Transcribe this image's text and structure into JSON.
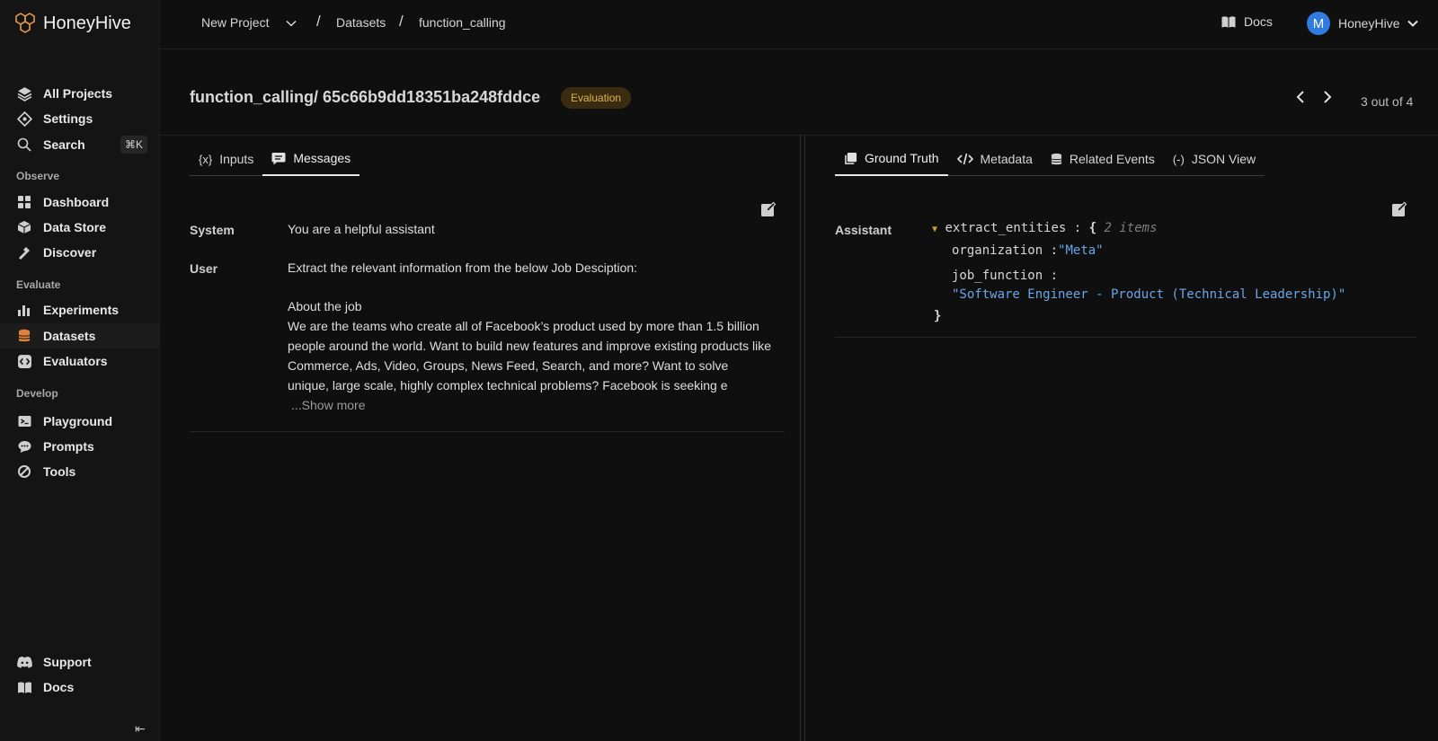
{
  "app": {
    "name": "HoneyHive"
  },
  "sidebar": {
    "items_top": [
      {
        "label": "All Projects",
        "icon": "layers-icon"
      },
      {
        "label": "Settings",
        "icon": "settings-icon"
      },
      {
        "label": "Search",
        "icon": "search-icon",
        "shortcut": "⌘K"
      }
    ],
    "sections": [
      {
        "label": "Observe",
        "items": [
          {
            "label": "Dashboard",
            "icon": "dashboard-icon"
          },
          {
            "label": "Data Store",
            "icon": "data-store-icon"
          },
          {
            "label": "Discover",
            "icon": "discover-icon"
          }
        ]
      },
      {
        "label": "Evaluate",
        "items": [
          {
            "label": "Experiments",
            "icon": "bar-chart-icon"
          },
          {
            "label": "Datasets",
            "icon": "database-icon",
            "active": true
          },
          {
            "label": "Evaluators",
            "icon": "evaluator-icon"
          }
        ]
      },
      {
        "label": "Develop",
        "items": [
          {
            "label": "Playground",
            "icon": "terminal-icon"
          },
          {
            "label": "Prompts",
            "icon": "chat-icon"
          },
          {
            "label": "Tools",
            "icon": "tools-icon"
          }
        ]
      }
    ],
    "bottom": [
      {
        "label": "Support",
        "icon": "discord-icon"
      },
      {
        "label": "Docs",
        "icon": "book-icon"
      }
    ],
    "collapse_glyph": "⇤"
  },
  "topbar": {
    "project": "New Project",
    "crumbs": [
      "Datasets",
      "function_calling"
    ],
    "separator": "/",
    "docs": "Docs",
    "user_initial": "M",
    "user_name": "HoneyHive"
  },
  "header": {
    "title": "function_calling/ 65c66b9dd18351ba248fddce",
    "badge": "Evaluation",
    "pager": "3 out of 4",
    "prev": "‹",
    "next": "›"
  },
  "left_panel": {
    "tabs": [
      {
        "label": "Inputs",
        "icon": "{x}"
      },
      {
        "label": "Messages",
        "icon": "message-icon",
        "active": true
      }
    ],
    "messages": [
      {
        "role": "System",
        "content": "You are a helpful assistant"
      },
      {
        "role": "User",
        "line1": "Extract the relevant information from the below Job Desciption:",
        "line2": "About the job",
        "line3": "We are the teams who create all of Facebook’s product used by more than 1.5 billion people around the world. Want to build new features and improve existing products like Commerce, Ads, Video, Groups, News Feed, Search, and more? Want to solve unique, large scale, highly complex technical problems? Facebook is seeking e",
        "show_more": "...Show more"
      }
    ]
  },
  "right_panel": {
    "tabs": [
      {
        "label": "Ground Truth",
        "icon": "copy-icon",
        "active": true
      },
      {
        "label": "Metadata",
        "icon": "code-icon"
      },
      {
        "label": "Related Events",
        "icon": "database-icon"
      },
      {
        "label": "JSON View",
        "icon": "json-icon"
      }
    ],
    "role": "Assistant",
    "json": {
      "root_key": "extract_entities",
      "colon": ":",
      "open": "{",
      "count": "2 items",
      "k1": "organization",
      "v1": "\"Meta\"",
      "k2": "job_function",
      "v2": "\"Software Engineer - Product (Technical Leadership)\"",
      "close": "}"
    }
  }
}
